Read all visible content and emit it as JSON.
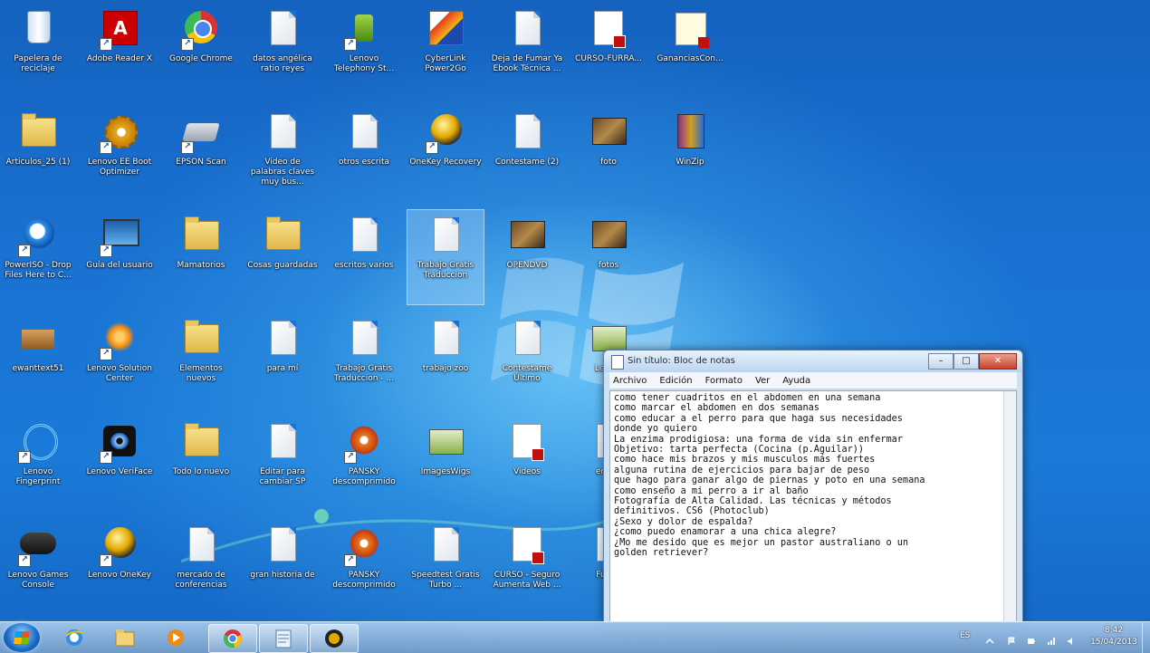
{
  "desktop": {
    "icons": [
      {
        "label": "Papelera de reciclaje",
        "kind": "recycle"
      },
      {
        "label": "Adobe Reader X",
        "kind": "adobe"
      },
      {
        "label": "Google Chrome",
        "kind": "chrome"
      },
      {
        "label": "datos angélica ratio reyes",
        "kind": "doc"
      },
      {
        "label": "Lenovo Telephony St...",
        "kind": "lenovo-ts"
      },
      {
        "label": "CyberLink Power2Go",
        "kind": "cyber"
      },
      {
        "label": "Deja de Fumar Ya Ebook Técnica ...",
        "kind": "doc"
      },
      {
        "label": "CURSO-FURRA...",
        "kind": "pdfdoc"
      },
      {
        "label": "GananciasCon...",
        "kind": "yellowdoc"
      },
      {
        "label": "Articulos_25 (1)",
        "kind": "folder"
      },
      {
        "label": "Lenovo EE Boot Optimizer",
        "kind": "gear"
      },
      {
        "label": "EPSON Scan",
        "kind": "scanner"
      },
      {
        "label": "Video de palabras claves muy bus...",
        "kind": "doc"
      },
      {
        "label": "otros escrita",
        "kind": "doc"
      },
      {
        "label": "OneKey Recovery",
        "kind": "orb"
      },
      {
        "label": "Contestame (2)",
        "kind": "doc"
      },
      {
        "label": "foto",
        "kind": "photo"
      },
      {
        "label": "WinZip",
        "kind": "winrar"
      },
      {
        "label": "PowerISO - Drop Files Here to C...",
        "kind": "ie"
      },
      {
        "label": "Guía del usuario",
        "kind": "monitor"
      },
      {
        "label": "Mamatorios",
        "kind": "folder"
      },
      {
        "label": "Cosas guardadas",
        "kind": "folder"
      },
      {
        "label": "escritos varios",
        "kind": "doc"
      },
      {
        "label": "Trabajo Gratis Traduccion",
        "kind": "doc",
        "selected": true
      },
      {
        "label": "OPENDVD",
        "kind": "photo"
      },
      {
        "label": "fotos",
        "kind": "photo"
      },
      {
        "label": "ewanttext51",
        "kind": "box"
      },
      {
        "label": "Lenovo Solution Center",
        "kind": "orange"
      },
      {
        "label": "Elementos nuevos",
        "kind": "folder"
      },
      {
        "label": "para mí",
        "kind": "doc"
      },
      {
        "label": "Trabajo Gratis Traduccion - ...",
        "kind": "doc"
      },
      {
        "label": "trabajo zoo",
        "kind": "doc"
      },
      {
        "label": "Contestame Último",
        "kind": "doc"
      },
      {
        "label": "Lega...",
        "kind": "greencard"
      },
      {
        "label": "Lenovo Fingerprint",
        "kind": "fingerprint"
      },
      {
        "label": "Lenovo VeriFace",
        "kind": "eye"
      },
      {
        "label": "Todo lo nuevo",
        "kind": "folder"
      },
      {
        "label": "Editar para cambiar SP",
        "kind": "doc"
      },
      {
        "label": "PANSKY descomprimido",
        "kind": "flower"
      },
      {
        "label": "ImagesWigs",
        "kind": "greencard"
      },
      {
        "label": "Videos",
        "kind": "pdfdoc"
      },
      {
        "label": "eriel...",
        "kind": "doc"
      },
      {
        "label": "Lenovo Games Console",
        "kind": "games"
      },
      {
        "label": "Lenovo OneKey",
        "kind": "orb"
      },
      {
        "label": "mercado de conferencias",
        "kind": "doc"
      },
      {
        "label": "gran historia de",
        "kind": "doc"
      },
      {
        "label": "PANSKY descomprimido",
        "kind": "flower"
      },
      {
        "label": "Speedtest Gratis Turbo ...",
        "kind": "doc"
      },
      {
        "label": "CURSO - Seguro Aumenta Web ...",
        "kind": "pdfdoc"
      },
      {
        "label": "Fuer...",
        "kind": "doc"
      }
    ]
  },
  "notepad": {
    "title": "Sin título: Bloc de notas",
    "menu": [
      "Archivo",
      "Edición",
      "Formato",
      "Ver",
      "Ayuda"
    ],
    "buttons": {
      "minimize": "–",
      "maximize": "□",
      "close": "✕"
    },
    "content": "como tener cuadritos en el abdomen en una semana\ncomo marcar el abdomen en dos semanas\ncomo educar a el perro para que haga sus necesidades\ndonde yo quiero\nLa enzima prodigiosa: una forma de vida sin enfermar\nObjetivo: tarta perfecta (Cocina (p.Aguilar))\ncomo hace mis brazos y mis musculos más fuertes\nalguna rutina de ejercicios para bajar de peso\nque hago para ganar algo de piernas y poto en una semana\ncomo enseño a mi perro a ir al baño\nFotografía de Alta Calidad. Las técnicas y métodos\ndefinitivos. CS6 (Photoclub)\n¿Sexo y dolor de espalda?\n¿como puedo enamorar a una chica alegre?\n¿Mo me desido que es mejor un pastor australiano o un\ngolden retriever?"
  },
  "taskbar": {
    "items": [
      {
        "name": "internet-explorer",
        "active": false
      },
      {
        "name": "windows-explorer",
        "active": false
      },
      {
        "name": "media-player",
        "active": false
      },
      {
        "name": "google-chrome",
        "active": true
      },
      {
        "name": "notepad",
        "active": true
      },
      {
        "name": "onekey",
        "active": true
      }
    ],
    "language": "ES",
    "time": "8:42",
    "date": "15/04/2013"
  },
  "colors": {
    "desktop": "#1a72d2",
    "close_button": "#c8442c"
  }
}
